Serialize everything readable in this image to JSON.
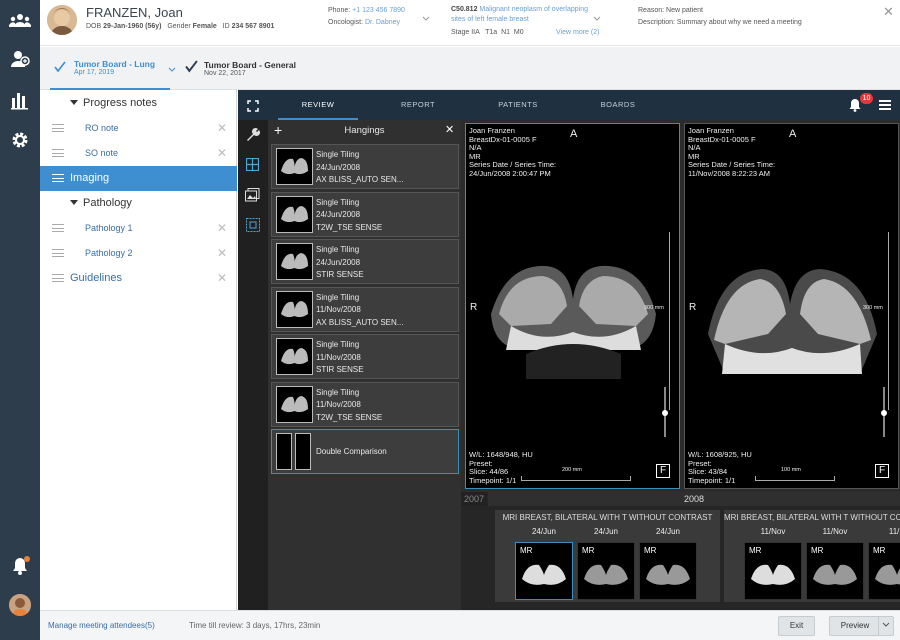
{
  "patient": {
    "name": "FRANZEN, Joan",
    "dob_label": "DOB",
    "dob": "29-Jan-1960 (56y)",
    "gender_label": "Gender",
    "gender": "Female",
    "id_label": "ID",
    "id": "234 567 8901",
    "phone_label": "Phone:",
    "phone": "+1 123 456 7890",
    "oncologist_label": "Oncologist:",
    "oncologist": "Dr. Dabney",
    "diagnosis_code": "C50.812",
    "diagnosis_text": "Malignant neoplasm of overlapping sites of left female breast",
    "stage": "Stage IIA   T1a  N1  M0",
    "view_more": "View more (2)",
    "reason_label": "Reason:",
    "reason": "New patient",
    "description_label": "Description:",
    "description": "Summary about why we need a meeting"
  },
  "boards": [
    {
      "name": "Tumor Board - Lung",
      "date": "Apr 17, 2019"
    },
    {
      "name": "Tumor Board - General",
      "date": "Nov 22, 2017"
    }
  ],
  "sidebar": {
    "items": [
      {
        "label": "Progress notes"
      },
      {
        "label": "RO note"
      },
      {
        "label": "SO note"
      },
      {
        "label": "Imaging"
      },
      {
        "label": "Pathology"
      },
      {
        "label": "Pathology 1"
      },
      {
        "label": "Pathology 2"
      },
      {
        "label": "Guidelines"
      }
    ]
  },
  "viewer": {
    "tabs": [
      "REVIEW",
      "REPORT",
      "PATIENTS",
      "BOARDS"
    ],
    "notification_count": "10",
    "hangings_title": "Hangings",
    "hangings": [
      {
        "title": "Single Tiling",
        "date": "24/Jun/2008",
        "series": "AX BLISS_AUTO SEN..."
      },
      {
        "title": "Single Tiling",
        "date": "24/Jun/2008",
        "series": "T2W_TSE SENSE"
      },
      {
        "title": "Single Tiling",
        "date": "24/Jun/2008",
        "series": "STIR SENSE"
      },
      {
        "title": "Single Tiling",
        "date": "11/Nov/2008",
        "series": "AX BLISS_AUTO SEN..."
      },
      {
        "title": "Single Tiling",
        "date": "11/Nov/2008",
        "series": "STIR SENSE"
      },
      {
        "title": "Single Tiling",
        "date": "11/Nov/2008",
        "series": "T2W_TSE SENSE"
      },
      {
        "title": "Double Comparison",
        "date": "",
        "series": ""
      }
    ],
    "viewports": [
      {
        "patient": "Joan Franzen",
        "patient_id": "BreastDx-01-0005 F",
        "na": "N/A",
        "modality": "MR",
        "series_label": "Series Date / Series Time:",
        "series_datetime": "24/Jun/2008 2:00:47 PM",
        "orientation_top": "A",
        "orientation_left": "R",
        "wl": "W/L: 1648/948, HU",
        "preset": "Preset:",
        "slice": "Slice: 44/86",
        "timepoint": "Timepoint: 1/1",
        "scale_h": "200 mm",
        "scale_v": "300 mm",
        "corner": "F"
      },
      {
        "patient": "Joan Franzen",
        "patient_id": "BreastDx-01-0005 F",
        "na": "N/A",
        "modality": "MR",
        "series_label": "Series Date / Series Time:",
        "series_datetime": "11/Nov/2008 8:22:23 AM",
        "orientation_top": "A",
        "orientation_left": "R",
        "wl": "W/L: 1608/925, HU",
        "preset": "Preset:",
        "slice": "Slice: 43/84",
        "timepoint": "Timepoint: 1/1",
        "scale_h": "100 mm",
        "scale_v": "300 mm",
        "corner": "F"
      }
    ],
    "timeline": {
      "year_a": "2007",
      "year_b": "2008"
    },
    "studies": [
      {
        "title": "MRI BREAST, BILATERAL WITH T WITHOUT CONTRAST",
        "thumbs": [
          {
            "date": "24/Jun",
            "mod": "MR"
          },
          {
            "date": "24/Jun",
            "mod": "MR"
          },
          {
            "date": "24/Jun",
            "mod": "MR"
          }
        ]
      },
      {
        "title": "MRI BREAST, BILATERAL WITH T WITHOUT CONTRAST",
        "thumbs": [
          {
            "date": "11/Nov",
            "mod": "MR"
          },
          {
            "date": "11/Nov",
            "mod": "MR"
          },
          {
            "date": "11/N",
            "mod": "MR"
          }
        ]
      }
    ]
  },
  "footer": {
    "manage": "Manage meeting attendees(5)",
    "time_till": "Time till review: 3 days, 17hrs, 23min",
    "exit": "Exit",
    "preview": "Preview"
  },
  "colors": {
    "accent": "#3d8fd1",
    "nav": "#2e3d4c",
    "selection": "#3d8fd1"
  }
}
